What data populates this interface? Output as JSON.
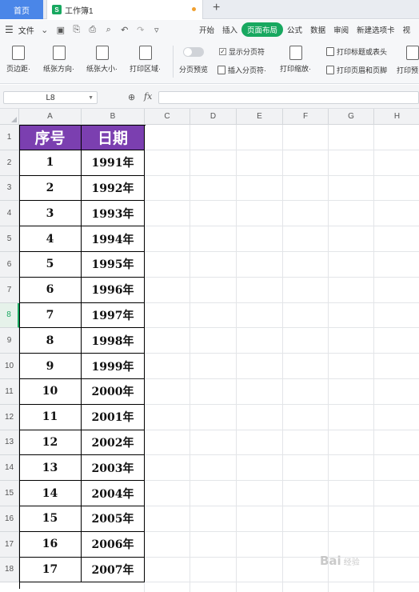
{
  "tabs": {
    "home": "首页",
    "doc_title": "工作簿1",
    "doc_icon": "S",
    "new_tab": "+"
  },
  "menu": {
    "file": "文件",
    "tabs": [
      "开始",
      "插入",
      "页面布局",
      "公式",
      "数据",
      "审阅",
      "新建选项卡"
    ],
    "active_tab": "页面布局",
    "more": "视"
  },
  "ribbon": {
    "margins": "页边距·",
    "orientation": "纸张方向·",
    "size": "纸张大小·",
    "print_area": "打印区域·",
    "page_break_preview": "分页预览",
    "show_page_break": "显示分页符",
    "insert_page_break": "插入分页符·",
    "print_scale": "打印缩放·",
    "print_titles": "打印标题或表头",
    "header_footer": "打印页眉和页脚",
    "print_more": "打印预"
  },
  "formula_bar": {
    "cell_ref": "L8",
    "fx_label": "fx",
    "value": ""
  },
  "grid": {
    "columns": [
      "A",
      "B",
      "C",
      "D",
      "E",
      "F",
      "G",
      "H"
    ],
    "rows": [
      "1",
      "2",
      "3",
      "4",
      "5",
      "6",
      "7",
      "8",
      "9",
      "10",
      "11",
      "12",
      "13",
      "14",
      "15",
      "16",
      "17",
      "18"
    ],
    "selected_row": "8"
  },
  "table": {
    "headers": [
      "序号",
      "日期"
    ],
    "rows": [
      [
        "1",
        "1991年"
      ],
      [
        "2",
        "1992年"
      ],
      [
        "3",
        "1993年"
      ],
      [
        "4",
        "1994年"
      ],
      [
        "5",
        "1995年"
      ],
      [
        "6",
        "1996年"
      ],
      [
        "7",
        "1997年"
      ],
      [
        "8",
        "1998年"
      ],
      [
        "9",
        "1999年"
      ],
      [
        "10",
        "2000年"
      ],
      [
        "11",
        "2001年"
      ],
      [
        "12",
        "2002年"
      ],
      [
        "13",
        "2003年"
      ],
      [
        "14",
        "2004年"
      ],
      [
        "15",
        "2005年"
      ],
      [
        "16",
        "2006年"
      ],
      [
        "17",
        "2007年"
      ]
    ],
    "header_color": "#7b3fb0"
  },
  "watermark": {
    "text": "Bai",
    "suffix": "经验"
  }
}
